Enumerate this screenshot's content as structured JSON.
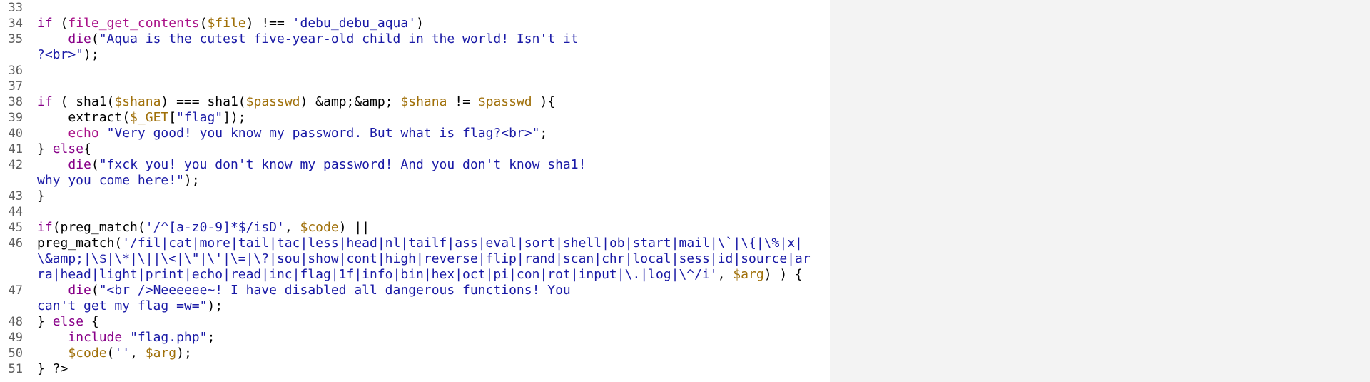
{
  "lines": [
    {
      "no": "33",
      "parts": [
        {
          "t": "pl",
          "v": ""
        }
      ]
    },
    {
      "no": "34",
      "parts": [
        {
          "t": "kw",
          "v": "if"
        },
        {
          "t": "pl",
          "v": " ("
        },
        {
          "t": "fn",
          "v": "file_get_contents"
        },
        {
          "t": "pl",
          "v": "("
        },
        {
          "t": "var",
          "v": "$file"
        },
        {
          "t": "pl",
          "v": ") !== "
        },
        {
          "t": "str",
          "v": "'debu_debu_aqua'"
        },
        {
          "t": "pl",
          "v": ")"
        }
      ]
    },
    {
      "no": "35",
      "parts": [
        {
          "t": "pl",
          "v": "    "
        },
        {
          "t": "kw",
          "v": "die"
        },
        {
          "t": "pl",
          "v": "("
        },
        {
          "t": "str",
          "v": "\"Aqua is the cutest five-year-old child in the world! Isn't it\n?<br>\""
        },
        {
          "t": "pl",
          "v": ");"
        }
      ]
    },
    {
      "no": "36",
      "parts": [
        {
          "t": "pl",
          "v": ""
        }
      ]
    },
    {
      "no": "37",
      "parts": [
        {
          "t": "pl",
          "v": ""
        }
      ]
    },
    {
      "no": "38",
      "parts": [
        {
          "t": "kw",
          "v": "if"
        },
        {
          "t": "pl",
          "v": " ( sha1("
        },
        {
          "t": "var",
          "v": "$shana"
        },
        {
          "t": "pl",
          "v": ") === sha1("
        },
        {
          "t": "var",
          "v": "$passwd"
        },
        {
          "t": "pl",
          "v": ") &amp;&amp; "
        },
        {
          "t": "var",
          "v": "$shana"
        },
        {
          "t": "pl",
          "v": " != "
        },
        {
          "t": "var",
          "v": "$passwd"
        },
        {
          "t": "pl",
          "v": " ){"
        }
      ]
    },
    {
      "no": "39",
      "parts": [
        {
          "t": "pl",
          "v": "    extract("
        },
        {
          "t": "var",
          "v": "$_GET"
        },
        {
          "t": "pl",
          "v": "["
        },
        {
          "t": "str",
          "v": "\"flag\""
        },
        {
          "t": "pl",
          "v": "]);"
        }
      ]
    },
    {
      "no": "40",
      "parts": [
        {
          "t": "pl",
          "v": "    "
        },
        {
          "t": "fn",
          "v": "echo"
        },
        {
          "t": "pl",
          "v": " "
        },
        {
          "t": "str",
          "v": "\"Very good! you know my password. But what is flag?<br>\""
        },
        {
          "t": "pl",
          "v": ";"
        }
      ]
    },
    {
      "no": "41",
      "parts": [
        {
          "t": "pl",
          "v": "} "
        },
        {
          "t": "kw",
          "v": "else"
        },
        {
          "t": "pl",
          "v": "{"
        }
      ]
    },
    {
      "no": "42",
      "parts": [
        {
          "t": "pl",
          "v": "    "
        },
        {
          "t": "kw",
          "v": "die"
        },
        {
          "t": "pl",
          "v": "("
        },
        {
          "t": "str",
          "v": "\"fxck you! you don't know my password! And you don't know sha1!\nwhy you come here!\""
        },
        {
          "t": "pl",
          "v": ");"
        }
      ]
    },
    {
      "no": "43",
      "parts": [
        {
          "t": "pl",
          "v": "}"
        }
      ]
    },
    {
      "no": "44",
      "parts": [
        {
          "t": "pl",
          "v": ""
        }
      ]
    },
    {
      "no": "45",
      "parts": [
        {
          "t": "kw",
          "v": "if"
        },
        {
          "t": "pl",
          "v": "(preg_match("
        },
        {
          "t": "str",
          "v": "'/^[a-z0-9]*$/isD'"
        },
        {
          "t": "pl",
          "v": ", "
        },
        {
          "t": "var",
          "v": "$code"
        },
        {
          "t": "pl",
          "v": ") ||"
        }
      ]
    },
    {
      "no": "46",
      "parts": [
        {
          "t": "pl",
          "v": "preg_match("
        },
        {
          "t": "str",
          "v": "'/fil|cat|more|tail|tac|less|head|nl|tailf|ass|eval|sort|shell|ob|start|mail|\\`|\\{|\\%|x|\\&amp;|\\$|\\*|\\||\\<|\\\"|\\'|\\=|\\?|sou|show|cont|high|reverse|flip|rand|scan|chr|local|sess|id|source|arra|head|light|print|echo|read|inc|flag|1f|info|bin|hex|oct|pi|con|rot|input|\\.|log|\\^/i'"
        },
        {
          "t": "pl",
          "v": ", "
        },
        {
          "t": "var",
          "v": "$arg"
        },
        {
          "t": "pl",
          "v": ") ) {"
        }
      ]
    },
    {
      "no": "47",
      "parts": [
        {
          "t": "pl",
          "v": "    "
        },
        {
          "t": "kw",
          "v": "die"
        },
        {
          "t": "pl",
          "v": "("
        },
        {
          "t": "str",
          "v": "\"<br />Neeeeee~! I have disabled all dangerous functions! You\ncan't get my flag =w=\""
        },
        {
          "t": "pl",
          "v": ");"
        }
      ]
    },
    {
      "no": "48",
      "parts": [
        {
          "t": "pl",
          "v": "} "
        },
        {
          "t": "kw",
          "v": "else"
        },
        {
          "t": "pl",
          "v": " {"
        }
      ]
    },
    {
      "no": "49",
      "parts": [
        {
          "t": "pl",
          "v": "    "
        },
        {
          "t": "kw",
          "v": "include"
        },
        {
          "t": "pl",
          "v": " "
        },
        {
          "t": "str",
          "v": "\"flag.php\""
        },
        {
          "t": "pl",
          "v": ";"
        }
      ]
    },
    {
      "no": "50",
      "parts": [
        {
          "t": "pl",
          "v": "    "
        },
        {
          "t": "var",
          "v": "$code"
        },
        {
          "t": "pl",
          "v": "("
        },
        {
          "t": "str",
          "v": "''"
        },
        {
          "t": "pl",
          "v": ", "
        },
        {
          "t": "var",
          "v": "$arg"
        },
        {
          "t": "pl",
          "v": ");"
        }
      ]
    },
    {
      "no": "51",
      "parts": [
        {
          "t": "pl",
          "v": "} ?>"
        }
      ]
    }
  ],
  "colors": {
    "keyword": "#880088",
    "function": "#aa1188",
    "variable": "#a0700a",
    "string": "#1a1aa6",
    "line_number": "#5e5e5e",
    "right_pane": "#f3f3f3"
  }
}
